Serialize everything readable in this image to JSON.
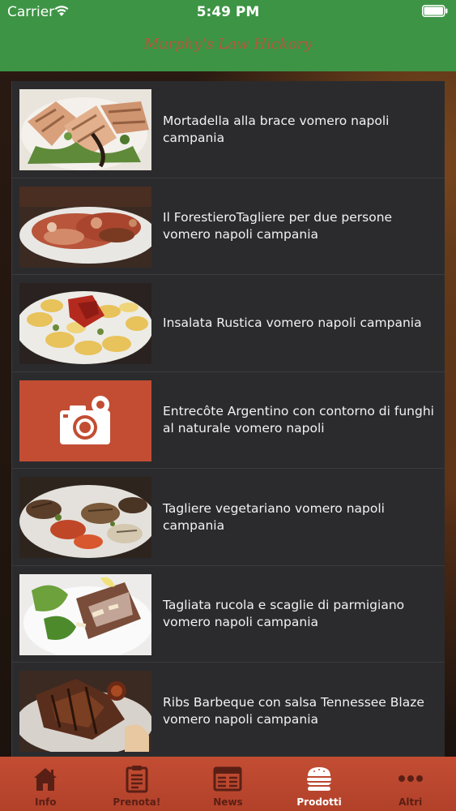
{
  "status_bar": {
    "carrier": "Carrier",
    "time": "5:49 PM"
  },
  "header": {
    "title": "Murphy's Law Hickory"
  },
  "colors": {
    "header_green": "#3d9445",
    "title_color": "#b5573a",
    "list_bg": "#2b2b2d",
    "tabbar_red": "#c24d33",
    "tab_inactive": "#5a1f14",
    "tab_active": "#ffffff"
  },
  "products": [
    {
      "name": "Mortadella alla brace vomero napoli campania",
      "image": "grilled-mortadella-photo"
    },
    {
      "name": "Il ForestieroTagliere per due persone vomero napoli campania",
      "image": "platter-photo"
    },
    {
      "name": "Insalata Rustica  vomero napoli campania",
      "image": "rustic-salad-photo"
    },
    {
      "name": "Entrecôte Argentino con contorno di funghi al naturale vomero napoli",
      "image": "camera-placeholder-icon"
    },
    {
      "name": "Tagliere vegetariano vomero napoli campania",
      "image": "vegetarian-platter-photo"
    },
    {
      "name": "Tagliata rucola e scaglie di parmigiano vomero napoli campania",
      "image": "tagliata-photo"
    },
    {
      "name": "Ribs Barbeque con salsa Tennessee Blaze vomero napoli campania",
      "image": "bbq-ribs-photo"
    }
  ],
  "tabs": [
    {
      "label": "Info",
      "icon": "home-icon",
      "active": false
    },
    {
      "label": "Prenota!",
      "icon": "clipboard-icon",
      "active": false
    },
    {
      "label": "News",
      "icon": "newspaper-icon",
      "active": false
    },
    {
      "label": "Prodotti",
      "icon": "burger-icon",
      "active": true
    },
    {
      "label": "Altri",
      "icon": "more-icon",
      "active": false
    }
  ]
}
